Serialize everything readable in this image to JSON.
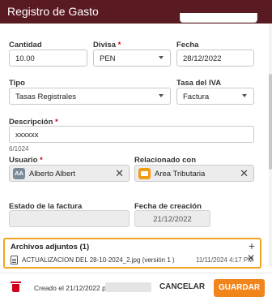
{
  "header": {
    "title": "Registro de Gasto"
  },
  "cantidad": {
    "label": "Cantidad",
    "value": "10.00"
  },
  "divisa": {
    "label": "Divisa",
    "required": "*",
    "value": "PEN"
  },
  "fecha": {
    "label": "Fecha",
    "value": "28/12/2022"
  },
  "tipo": {
    "label": "Tipo",
    "value": "Tasas Registrales"
  },
  "tasa_iva": {
    "label": "Tasa del IVA",
    "value": "Factura"
  },
  "descripcion": {
    "label": "Descripción",
    "required": "*",
    "value": "xxxxxx",
    "counter": "6/1024"
  },
  "usuario": {
    "label": "Usuario",
    "required": "*",
    "initials": "AA",
    "value": "Alberto Albert"
  },
  "relacionado": {
    "label": "Relacionado con",
    "value": "Area Tributaria"
  },
  "estado_factura": {
    "label": "Estado de la factura",
    "value": ""
  },
  "fecha_creacion": {
    "label": "Fecha de creación",
    "value": "21/12/2022"
  },
  "attachments": {
    "title": "Archivos adjuntos (1)",
    "files": [
      {
        "name": "ACTUALIZACION DEL 28-10-2024_2.jpg (versión 1 )",
        "date": "11/11/2024 4:17 PM"
      }
    ]
  },
  "footer": {
    "created_text": "Creado el 21/12/2022 por",
    "cancel_label": "CANCELAR",
    "save_label": "GUARDAR"
  },
  "colors": {
    "header": "#5a1a22",
    "accent": "#f2841c",
    "highlight": "#f0a422",
    "required": "#d0021b"
  }
}
